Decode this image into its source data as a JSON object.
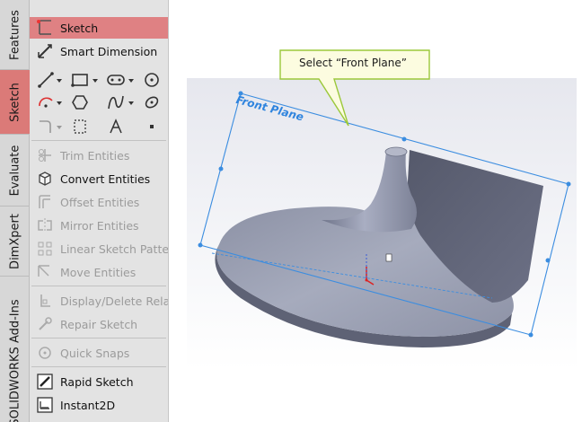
{
  "tabs": [
    {
      "label": "Features"
    },
    {
      "label": "Sketch"
    },
    {
      "label": "Evaluate"
    },
    {
      "label": "DimXpert"
    },
    {
      "label": "SOLIDWORKS Add-Ins"
    }
  ],
  "commands": {
    "sketch": "Sketch",
    "smart_dimension": "Smart Dimension",
    "trim_entities": "Trim Entities",
    "convert_entities": "Convert Entities",
    "offset_entities": "Offset Entities",
    "mirror_entities": "Mirror Entities",
    "linear_sketch_pattern": "Linear Sketch Patter",
    "move_entities": "Move Entities",
    "display_delete_relations": "Display/Delete Relat",
    "repair_sketch": "Repair Sketch",
    "quick_snaps": "Quick Snaps",
    "rapid_sketch": "Rapid Sketch",
    "instant2d": "Instant2D"
  },
  "toolbar_icons": [
    "line-icon",
    "rectangle-icon",
    "slot-icon",
    "circle-icon",
    "arc-icon",
    "polygon-icon",
    "spline-icon",
    "ellipse-icon",
    "fillet-icon",
    "construction-geometry-icon",
    "text-icon",
    "point-icon"
  ],
  "callout": {
    "text": "Select “Front Plane”"
  },
  "viewport": {
    "plane_label": "Front Plane"
  },
  "colors": {
    "active_tab": "#db7a78",
    "highlight": "#df8183",
    "plane": "#2f84de",
    "model": "#7a7f94"
  }
}
